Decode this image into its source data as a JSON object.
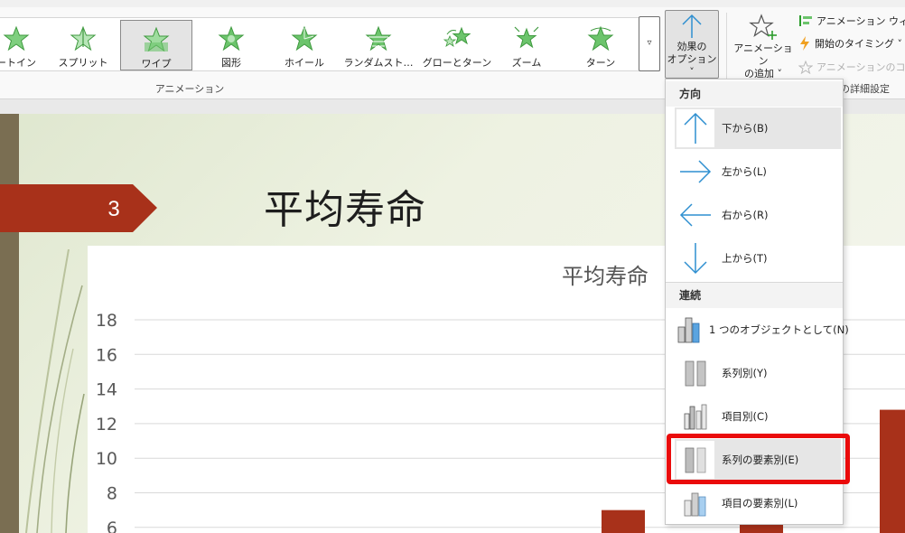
{
  "ribbon": {
    "gallery": [
      {
        "label": "ートイン",
        "icon": "star-icon"
      },
      {
        "label": "スプリット",
        "icon": "star-split-icon"
      },
      {
        "label": "ワイプ",
        "icon": "star-wipe-icon",
        "selected": true
      },
      {
        "label": "図形",
        "icon": "star-shape-icon"
      },
      {
        "label": "ホイール",
        "icon": "star-wheel-icon"
      },
      {
        "label": "ランダムスト…",
        "icon": "star-random-bars-icon"
      },
      {
        "label": "グローとターン",
        "icon": "star-grow-turn-icon"
      },
      {
        "label": "ズーム",
        "icon": "star-zoom-icon"
      },
      {
        "label": "ターン",
        "icon": "star-swivel-icon"
      }
    ],
    "more_glyph": "▿",
    "group_label": "アニメーション",
    "effect_options": {
      "line1": "効果の",
      "line2": "オプション ˅"
    },
    "add_animation": {
      "line1": "アニメーション",
      "line2": "の追加 ˅"
    },
    "anim_pane": "アニメーション ウィンド",
    "trigger": "開始のタイミング ˅",
    "anim_painter": "アニメーションのコピー",
    "detail_label": "の詳細設定"
  },
  "slide": {
    "number": "3",
    "title": "平均寿命"
  },
  "chart_data": {
    "type": "bar",
    "title": "平均寿命",
    "y_ticks": [
      "18",
      "16",
      "14",
      "12",
      "10",
      "8",
      "6"
    ],
    "ylim": [
      6,
      18
    ],
    "series": [
      {
        "name": "",
        "values": [
          7,
          7,
          12.8
        ]
      }
    ],
    "bar_color": "#a8311a"
  },
  "dropdown": {
    "section_direction": "方向",
    "directions": [
      {
        "label": "下から(B)",
        "icon": "arrow-up-icon"
      },
      {
        "label": "左から(L)",
        "icon": "arrow-right-icon"
      },
      {
        "label": "右から(R)",
        "icon": "arrow-left-icon"
      },
      {
        "label": "上から(T)",
        "icon": "arrow-down-icon"
      }
    ],
    "section_sequence": "連続",
    "sequences": [
      {
        "label": "1 つのオブジェクトとして(N)",
        "icon": "as-one-object-icon"
      },
      {
        "label": "系列別(Y)",
        "icon": "by-series-icon"
      },
      {
        "label": "項目別(C)",
        "icon": "by-category-icon"
      },
      {
        "label": "系列の要素別(E)",
        "icon": "by-element-in-series-icon"
      },
      {
        "label": "項目の要素別(L)",
        "icon": "by-element-in-category-icon"
      }
    ]
  },
  "colors": {
    "accent_red": "#a8311a",
    "arrow_blue": "#2e8fd0",
    "highlight_red": "#ea0b0b",
    "star_green": "#5cb85c"
  }
}
